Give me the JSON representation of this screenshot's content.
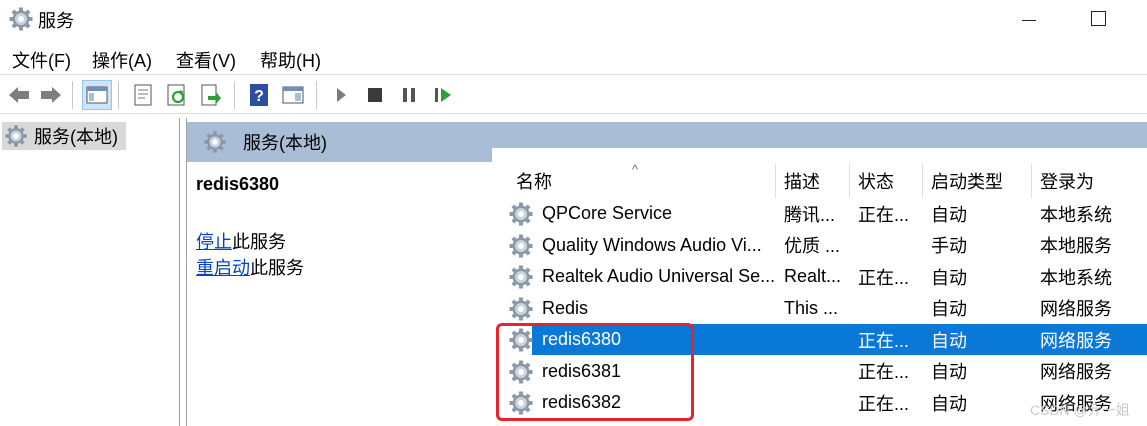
{
  "window": {
    "title": "服务"
  },
  "menu": [
    "文件(F)",
    "操作(A)",
    "查看(V)",
    "帮助(H)"
  ],
  "toolbar": {
    "buttons": [
      "back-arrow-icon",
      "forward-arrow-icon",
      "console-tree-icon",
      "properties-icon",
      "refresh-icon",
      "export-icon",
      "help-icon",
      "action-pane-icon",
      "play-icon",
      "stop-icon",
      "pause-icon",
      "resume-icon"
    ]
  },
  "tree": {
    "item": "服务(本地)"
  },
  "panel": {
    "header": "服务(本地)"
  },
  "details": {
    "title": "redis6380",
    "stop_link": "停止",
    "stop_suffix": "此服务",
    "restart_link": "重启动",
    "restart_suffix": "此服务"
  },
  "columns": [
    "名称",
    "描述",
    "状态",
    "启动类型",
    "登录为"
  ],
  "rows": [
    {
      "name": "QPCore Service",
      "desc": "腾讯...",
      "status": "正在...",
      "startup": "自动",
      "logon": "本地系统",
      "selected": false
    },
    {
      "name": "Quality Windows Audio Vi...",
      "desc": "优质 ...",
      "status": "",
      "startup": "手动",
      "logon": "本地服务",
      "selected": false
    },
    {
      "name": "Realtek Audio Universal Se...",
      "desc": "Realt...",
      "status": "正在...",
      "startup": "自动",
      "logon": "本地系统",
      "selected": false
    },
    {
      "name": "Redis",
      "desc": "This ...",
      "status": "",
      "startup": "自动",
      "logon": "网络服务",
      "selected": false
    },
    {
      "name": "redis6380",
      "desc": "",
      "status": "正在...",
      "startup": "自动",
      "logon": "网络服务",
      "selected": true
    },
    {
      "name": "redis6381",
      "desc": "",
      "status": "正在...",
      "startup": "自动",
      "logon": "网络服务",
      "selected": false
    },
    {
      "name": "redis6382",
      "desc": "",
      "status": "正在...",
      "startup": "自动",
      "logon": "网络服务",
      "selected": false
    }
  ],
  "watermark": "CSDN @亓一姐",
  "colors": {
    "selection": "#0a78d7",
    "header_band": "#a9bdd6",
    "highlight": "#e8232b",
    "link": "#0044cc"
  }
}
